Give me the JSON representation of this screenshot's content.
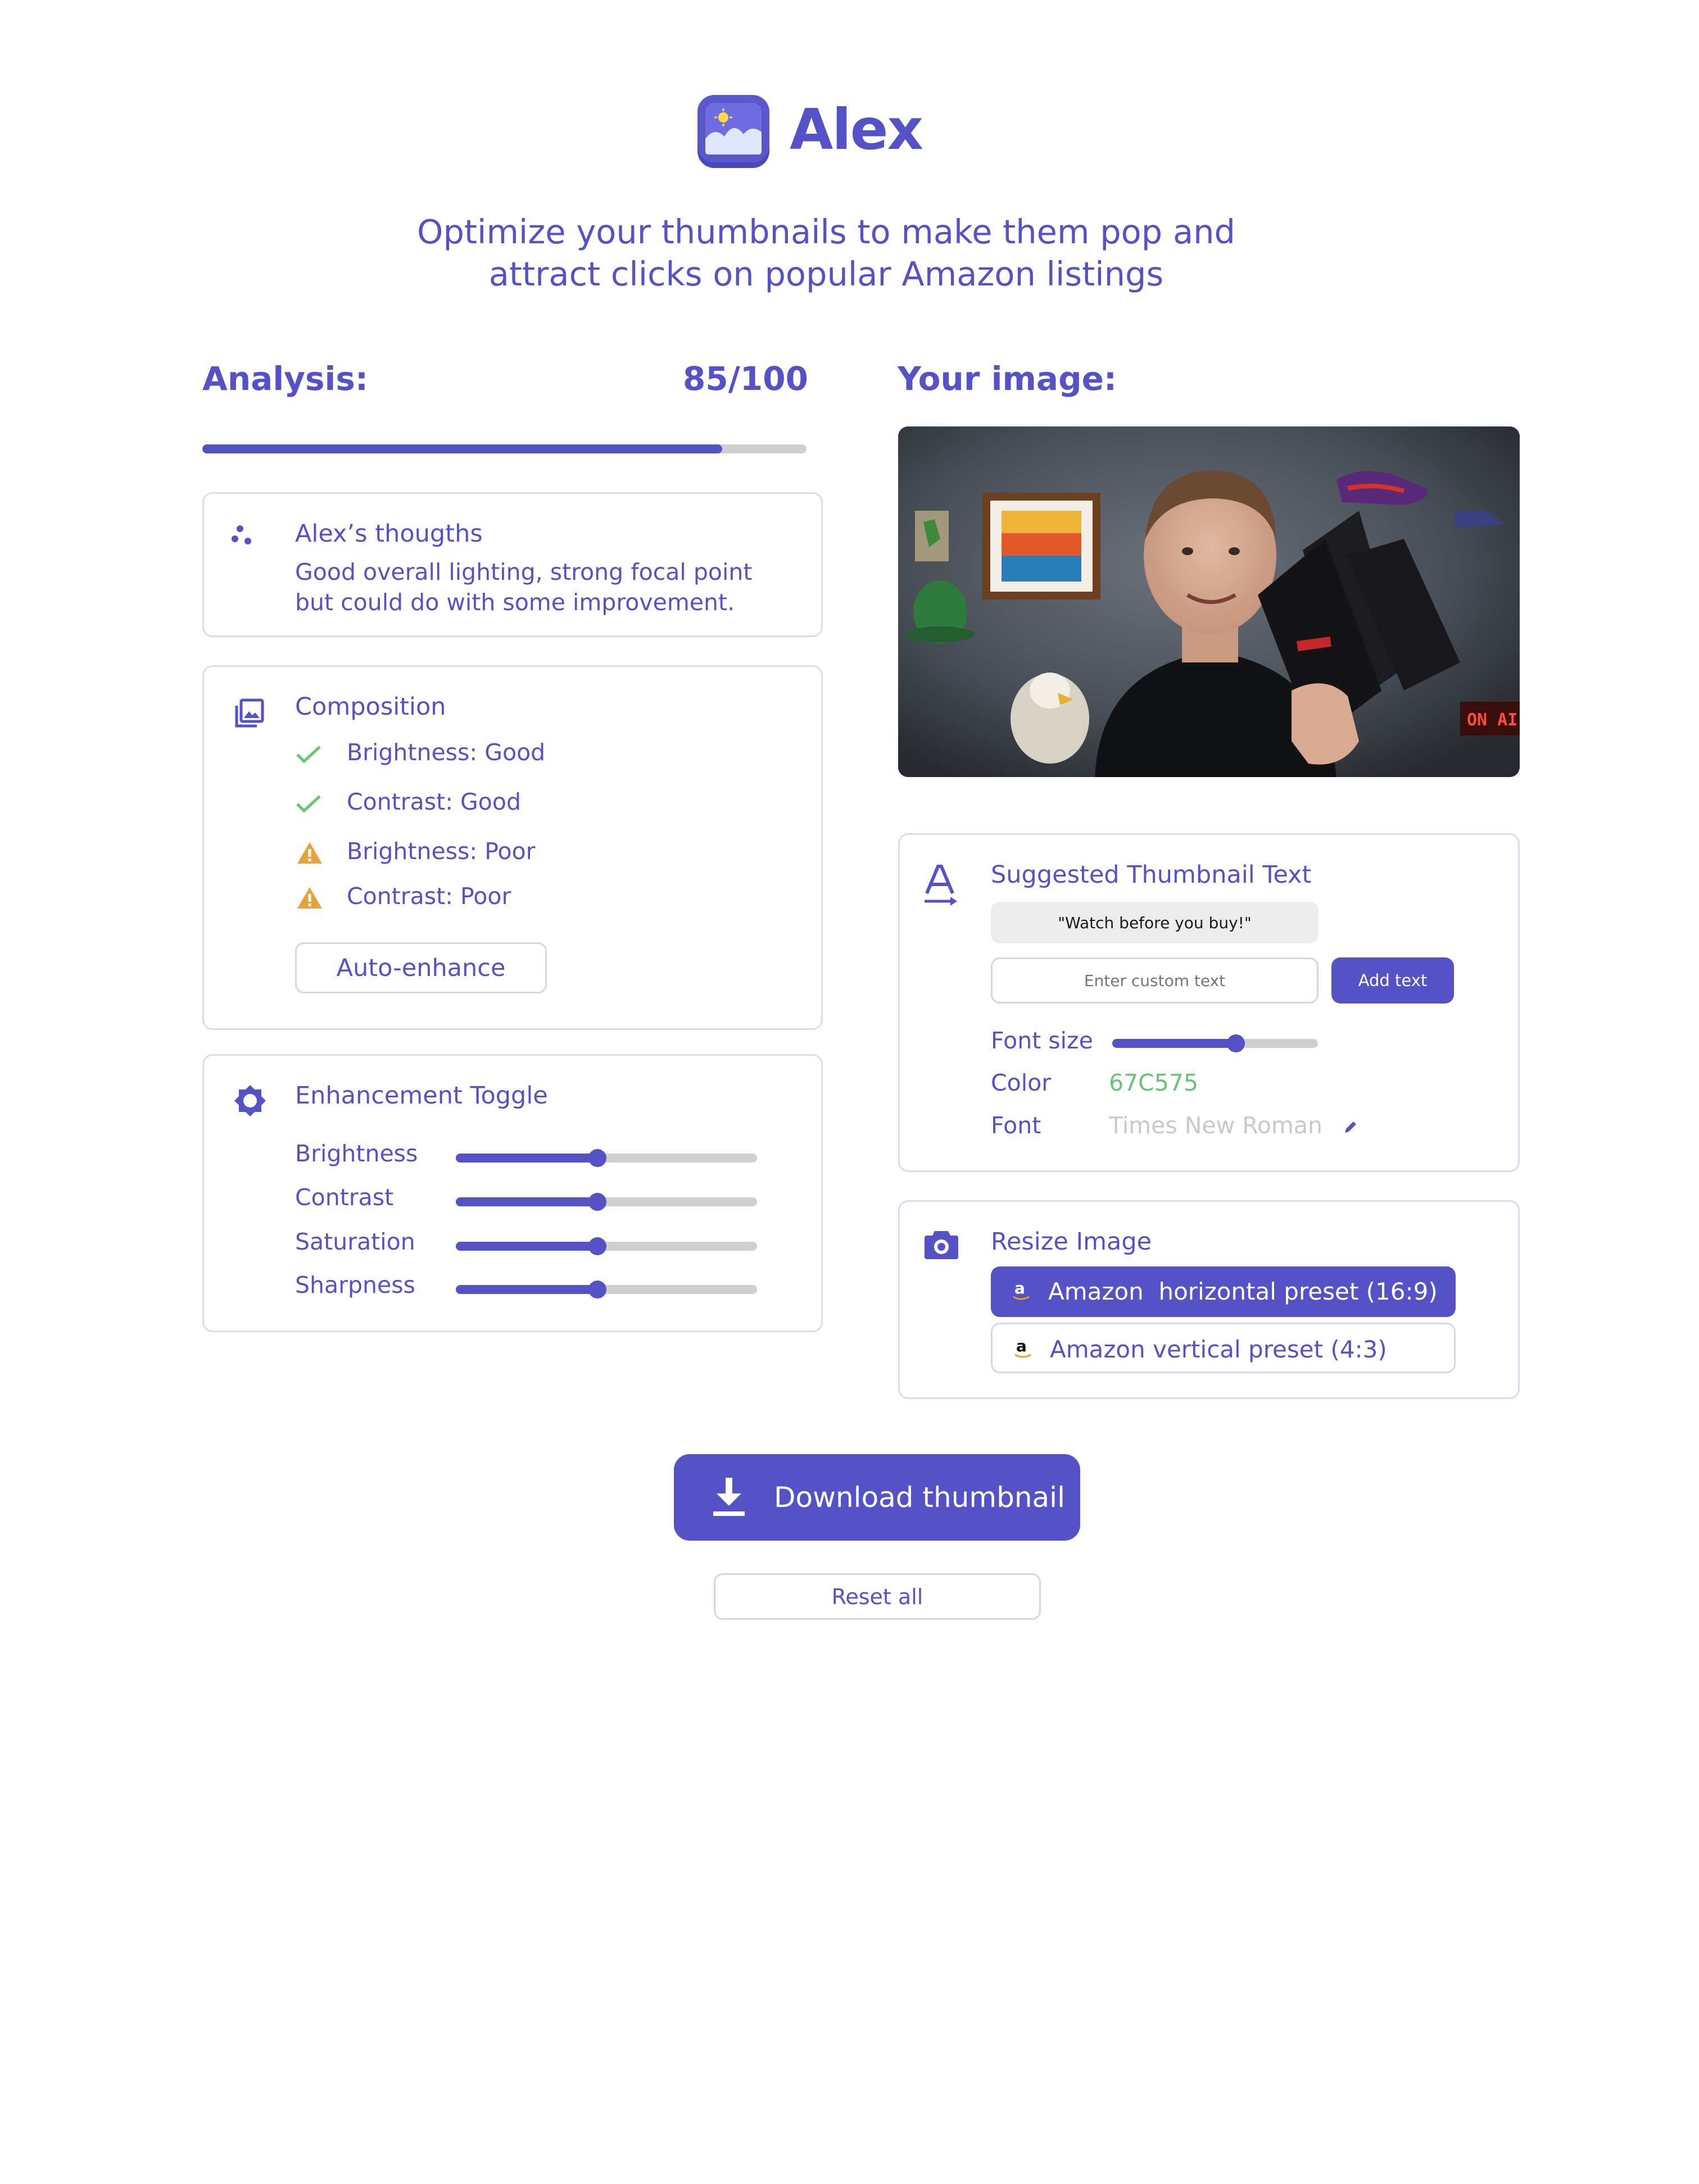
{
  "app": {
    "name": "Alex",
    "tagline_line1": "Optimize your thumbnails to make them pop and",
    "tagline_line2": "attract clicks on popular Amazon listings"
  },
  "analysis": {
    "label": "Analysis:",
    "score": "85/100",
    "progress_fraction": 0.86
  },
  "thoughts": {
    "title": "Alex’s thougths",
    "line1": "Good overall lighting, strong focal point",
    "line2": "but could do with some improvement."
  },
  "composition": {
    "title": "Composition",
    "items": [
      {
        "label": "Brightness: Good",
        "status": "good"
      },
      {
        "label": "Contrast: Good",
        "status": "good"
      },
      {
        "label": "Brightness: Poor",
        "status": "poor"
      },
      {
        "label": "Contrast: Poor",
        "status": "poor"
      }
    ],
    "auto_enhance_label": "Auto-enhance"
  },
  "enhancement": {
    "title": "Enhancement Toggle",
    "sliders": [
      {
        "label": "Brightness",
        "value": 0.47
      },
      {
        "label": "Contrast",
        "value": 0.47
      },
      {
        "label": "Saturation",
        "value": 0.47
      },
      {
        "label": "Sharpness",
        "value": 0.47
      }
    ]
  },
  "your_image": {
    "label": "Your image:",
    "sign_text": "ON AI"
  },
  "thumbnail_text": {
    "title": "Suggested Thumbnail Text",
    "suggestion": "\"Watch before you buy!\"",
    "custom_placeholder": "Enter custom text",
    "add_button": "Add text",
    "font_size_label": "Font size",
    "font_size_value": 0.6,
    "color_label": "Color",
    "color_value": "67C575",
    "font_label": "Font",
    "font_value": "Times New Roman"
  },
  "resize": {
    "title": "Resize Image",
    "presets": [
      {
        "label": "Amazon  horizontal preset (16:9)",
        "selected": true
      },
      {
        "label": "Amazon vertical preset (4:3)",
        "selected": false
      }
    ]
  },
  "actions": {
    "download": "Download thumbnail",
    "reset": "Reset all"
  },
  "colors": {
    "accent": "#5552c8",
    "good": "#67c575",
    "warning": "#e6a23c",
    "muted": "#cfcfcf"
  },
  "icons": {
    "logo": "mountain-photo-logo-icon",
    "thoughts": "dots-icon",
    "composition": "image-stack-icon",
    "enhancement": "sun-gear-icon",
    "text": "text-a-icon",
    "resize": "camera-icon",
    "download": "download-icon",
    "amazon": "amazon-a-icon",
    "edit": "pencil-icon"
  }
}
